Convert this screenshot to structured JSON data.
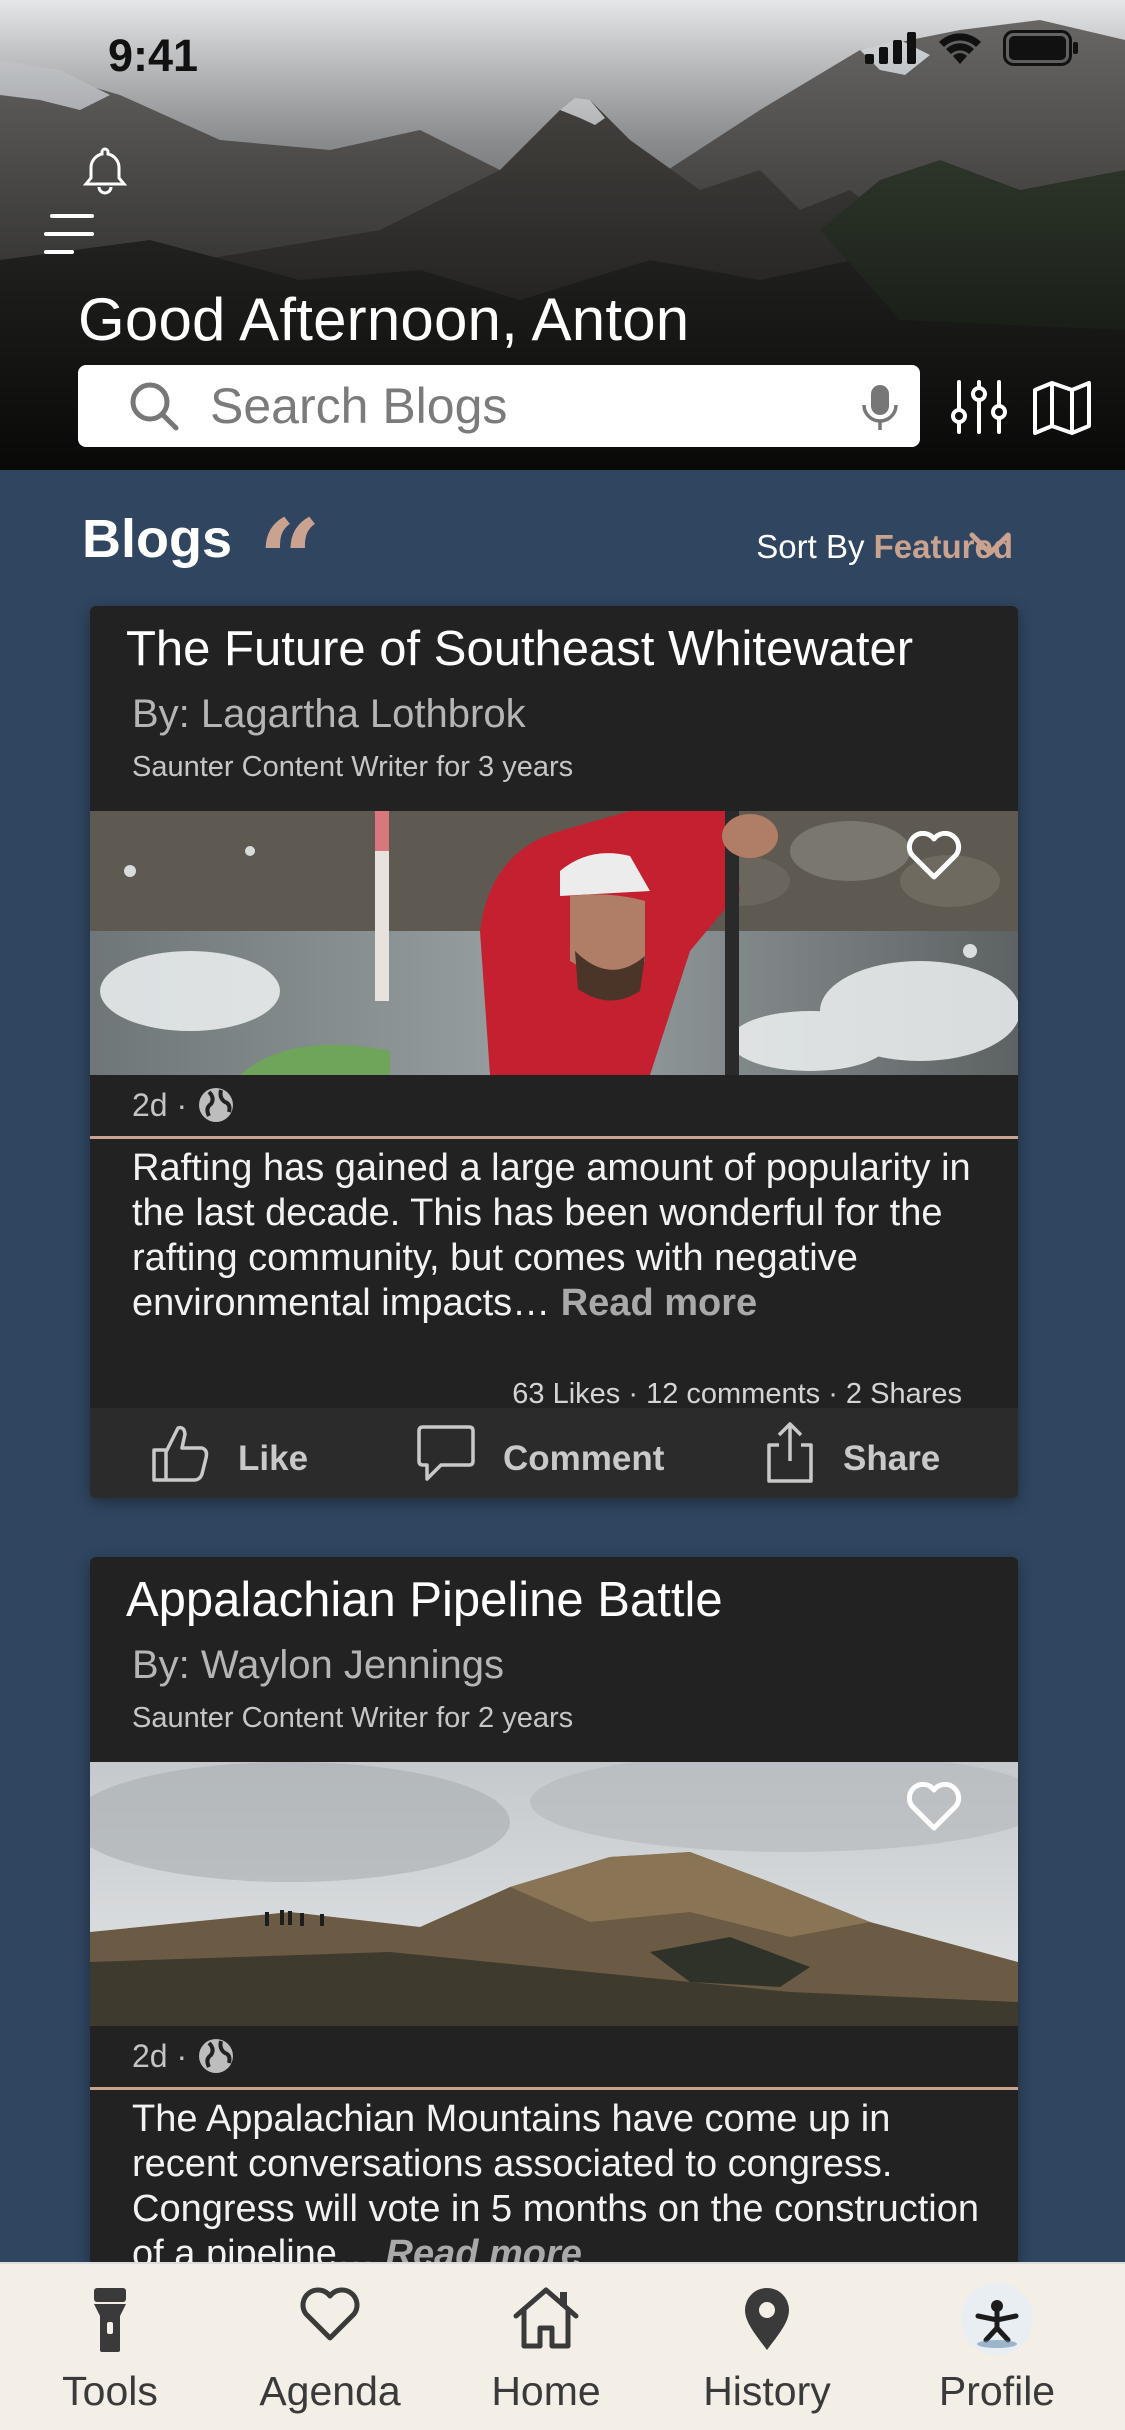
{
  "status_bar": {
    "time": "9:41"
  },
  "header": {
    "greeting": "Good Afternoon, Anton",
    "search_placeholder": "Search Blogs"
  },
  "section": {
    "title": "Blogs",
    "sort_label": "Sort By",
    "sort_value": "Featured"
  },
  "posts": [
    {
      "title": "The Future of Southeast Whitewater",
      "author": "By: Lagartha Lothbrok",
      "role": "Saunter Content Writer for 3 years",
      "age": "2d ·",
      "excerpt": "Rafting has gained a large amount of popularity in the last decade. This has been wonderful for the rafting community, but comes with negative environmental impacts…",
      "read_more": "Read more",
      "stats": "63 Likes · 12 comments · 2 Shares",
      "like_label": "Like",
      "comment_label": "Comment",
      "share_label": "Share",
      "image": "kayaker-whitewater"
    },
    {
      "title": "Appalachian Pipeline Battle",
      "author": "By: Waylon Jennings",
      "role": "Saunter Content Writer for 2 years",
      "age": "2d ·",
      "excerpt": "The Appalachian Mountains have come up in recent conversations associated to congress. Congress will vote in 5 months on the construction of a pipeline…",
      "read_more": "Read more",
      "image": "hikers-on-ridge"
    }
  ],
  "tabbar": {
    "tabs": [
      {
        "label": "Tools",
        "icon": "flashlight-icon"
      },
      {
        "label": "Agenda",
        "icon": "heart-icon"
      },
      {
        "label": "Home",
        "icon": "home-icon"
      },
      {
        "label": "History",
        "icon": "location-pin-icon"
      },
      {
        "label": "Profile",
        "icon": "avatar"
      }
    ]
  },
  "colors": {
    "background": "#2f4560",
    "accent": "#c9a290",
    "card": "#222222",
    "tabbar": "#f3efe7"
  }
}
